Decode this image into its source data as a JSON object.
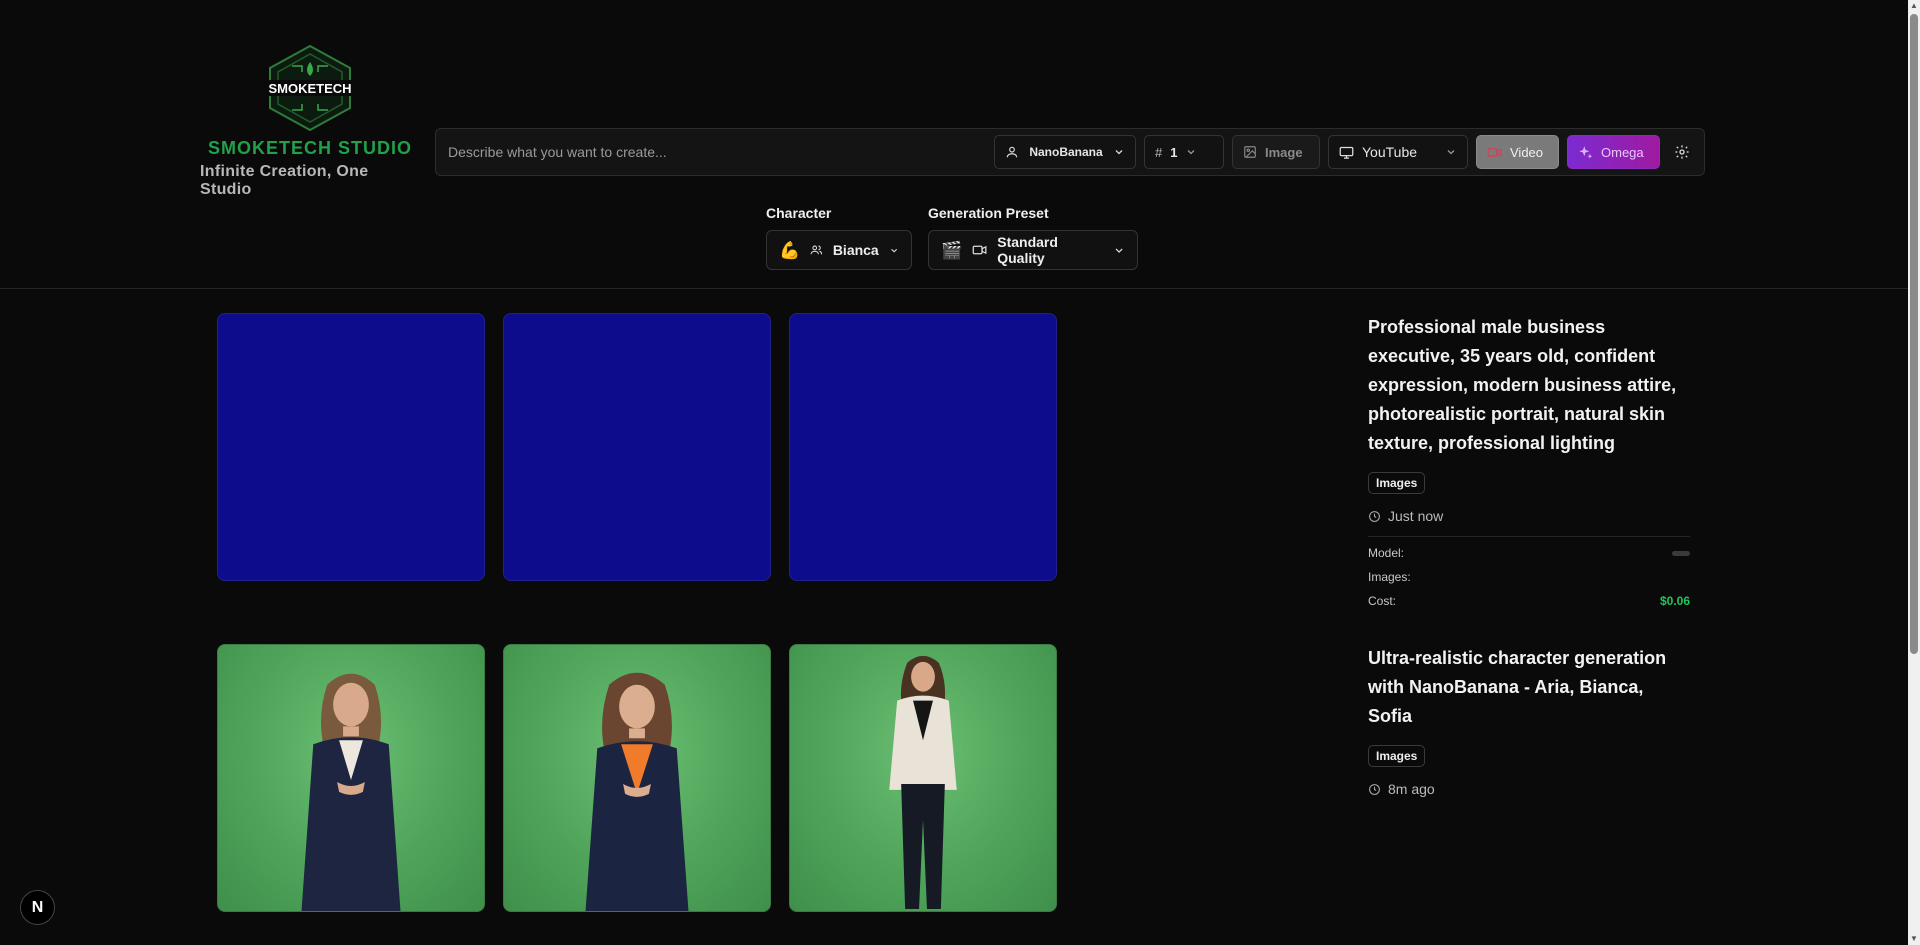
{
  "brand": {
    "logo_text": "SMOKETECH",
    "title": "SMOKETECH STUDIO",
    "subtitle": "Infinite Creation, One Studio"
  },
  "prompt": {
    "placeholder": "Describe what you want to create...",
    "value": ""
  },
  "toolbar": {
    "model": "NanoBanana",
    "count": "1",
    "image_label": "Image",
    "platform": "YouTube",
    "video_label": "Video",
    "omega_label": "Omega"
  },
  "character": {
    "label": "Character",
    "emoji": "💪",
    "value": "Bianca"
  },
  "preset": {
    "label": "Generation Preset",
    "emoji": "🎬",
    "value": "Standard Quality"
  },
  "history": [
    {
      "title": "Professional male business executive, 35 years old, confident expression, modern business attire, photorealistic portrait, natural skin texture, professional lighting",
      "badge": "Images",
      "time": "Just now",
      "meta": {
        "model_label": "Model:",
        "images_label": "Images:",
        "cost_label": "Cost:",
        "cost_value": "$0.06"
      }
    },
    {
      "title": "Ultra-realistic character generation with NanoBanana - Aria, Bianca, Sofia",
      "badge": "Images",
      "time": "8m ago"
    }
  ],
  "colors": {
    "brand_green": "#22a04a",
    "placeholder_blue": "#0c0c8c",
    "cost_green": "#22c55e",
    "omega_purple": "#7b2bd1"
  },
  "dev_badge": "N"
}
